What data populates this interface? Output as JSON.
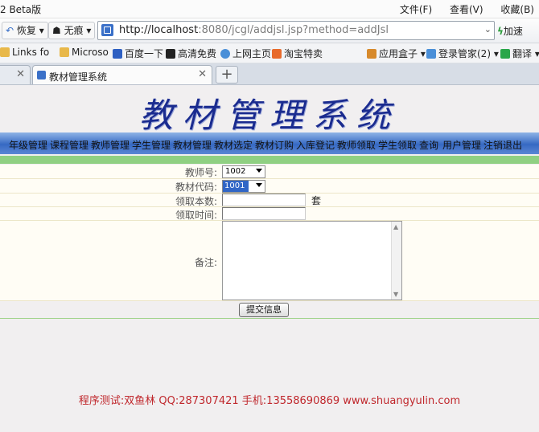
{
  "browser": {
    "title": "2 Beta版",
    "menus": [
      "文件(F)",
      "查看(V)",
      "收藏(B)"
    ],
    "back_label": "恢复",
    "home_label": "无痕",
    "url": {
      "host": "http://localhost",
      "rest": ":8080/jcgl/addjsl.jsp?method=addJsl"
    },
    "speed_label": "加速",
    "bookmarks": [
      {
        "label": "Links fo",
        "icon": "folder-icon",
        "color": "#e8b84a"
      },
      {
        "label": "Microso",
        "icon": "folder-icon",
        "color": "#e8b84a"
      },
      {
        "label": "百度一下",
        "icon": "baidu-paw-icon",
        "color": "#2d5fc2"
      },
      {
        "label": "高清免费",
        "icon": "movie-icon",
        "color": "#222222"
      },
      {
        "label": "上网主页",
        "icon": "globe-icon",
        "color": "#4a8fd8"
      },
      {
        "label": "淘宝特卖",
        "icon": "taobao-icon",
        "color": "#e86b2c"
      },
      {
        "label": "应用盒子 ▾",
        "icon": "box-icon",
        "color": "#d78a2c"
      },
      {
        "label": "登录管家(2) ▾",
        "icon": "key-icon",
        "color": "#4a8fd8"
      },
      {
        "label": "翻译 ▾",
        "icon": "translate-icon",
        "color": "#2aa64a"
      }
    ],
    "tabs": [
      {
        "label": ""
      },
      {
        "label": "教材管理系统"
      }
    ]
  },
  "page": {
    "title": "教材管理系统",
    "nav": [
      "年级管理",
      "课程管理",
      "教师管理",
      "学生管理",
      "教材管理",
      "教材选定",
      "教材订购",
      "入库登记",
      "教师领取",
      "学生领取",
      "查询",
      "用户管理",
      "注销退出"
    ],
    "form": {
      "teacher_no_label": "教师号:",
      "teacher_no_value": "1002",
      "book_code_label": "教材代码:",
      "book_code_value": "1001",
      "quantity_label": "领取本数:",
      "quantity_unit": "套",
      "time_label": "领取时间:",
      "notes_label": "备注:",
      "submit_label": "提交信息"
    },
    "footer": "程序测试:双鱼林  QQ:287307421  手机:13558690869 www.shuangyulin.com"
  },
  "colors": {
    "title": "#1a2b8f",
    "nav": "#3669c3",
    "accent_bar": "#8fd082",
    "footer": "#c0282d"
  }
}
